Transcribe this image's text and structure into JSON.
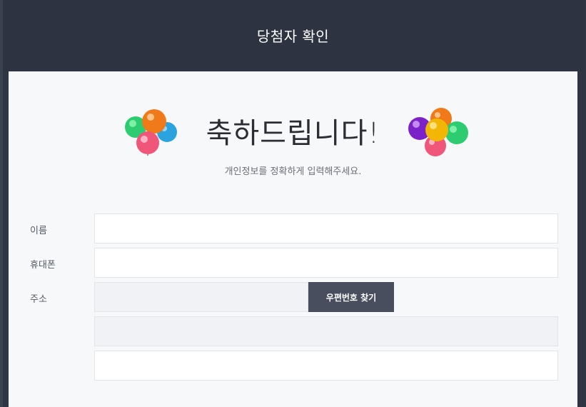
{
  "header": {
    "title": "당첨자 확인"
  },
  "hero": {
    "title": "축하드립니다!",
    "subtitle": "개인정보를 정확하게 입력해주세요.",
    "left_icon": "balloons-icon",
    "right_icon": "balloons-icon"
  },
  "form": {
    "name_label": "이름",
    "name_value": "",
    "phone_label": "휴대폰",
    "phone_value": "",
    "address_label": "주소",
    "zipcode_value": "",
    "zip_button_label": "우편번호 찾기",
    "address_value": "",
    "address_detail_value": ""
  },
  "colors": {
    "header_bg": "#2d3340",
    "body_bg": "#f7f8fa",
    "button_bg": "#484e5e"
  }
}
